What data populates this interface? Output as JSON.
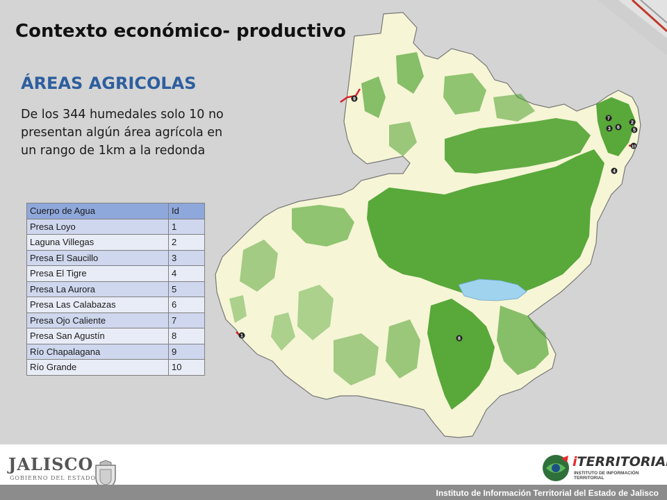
{
  "slide": {
    "title": "Contexto económico- productivo",
    "subtitle": "ÁREAS AGRICOLAS",
    "description": "De los 344 humedales solo  10 no presentan algún área agrícola en un rango de 1km a la redonda"
  },
  "table": {
    "headers": [
      "Cuerpo de Agua",
      "Id"
    ],
    "rows": [
      {
        "name": "Presa Loyo",
        "id": "1"
      },
      {
        "name": "Laguna Villegas",
        "id": "2"
      },
      {
        "name": "Presa El Saucillo",
        "id": "3"
      },
      {
        "name": "Presa El Tigre",
        "id": "4"
      },
      {
        "name": "Presa La Aurora",
        "id": "5"
      },
      {
        "name": "Presa Las Calabazas",
        "id": "6"
      },
      {
        "name": "Presa Ojo Caliente",
        "id": "7"
      },
      {
        "name": "Presa San Agustín",
        "id": "8"
      },
      {
        "name": "Río Chapalagana",
        "id": "9"
      },
      {
        "name": "Río Grande",
        "id": "10"
      }
    ]
  },
  "map": {
    "markers": [
      "1",
      "2",
      "3",
      "4",
      "5",
      "6",
      "7",
      "8",
      "9",
      "10"
    ],
    "colors": {
      "land": "#f6f5d6",
      "agriculture": "#3d9a1e",
      "water": "#9fd3ee",
      "river": "#d9202a",
      "border": "#777777"
    }
  },
  "footer": {
    "text": "Instituto de Información Territorial del Estado de Jalisco",
    "logo_left_word": "JALISCO",
    "logo_left_sub": "GOBIERNO DEL ESTADO",
    "logo_right_word_i": "i",
    "logo_right_word": "TERRITORIAL",
    "logo_right_sub": "INSTITUTO DE INFORMACIÓN TERRITORIAL"
  }
}
